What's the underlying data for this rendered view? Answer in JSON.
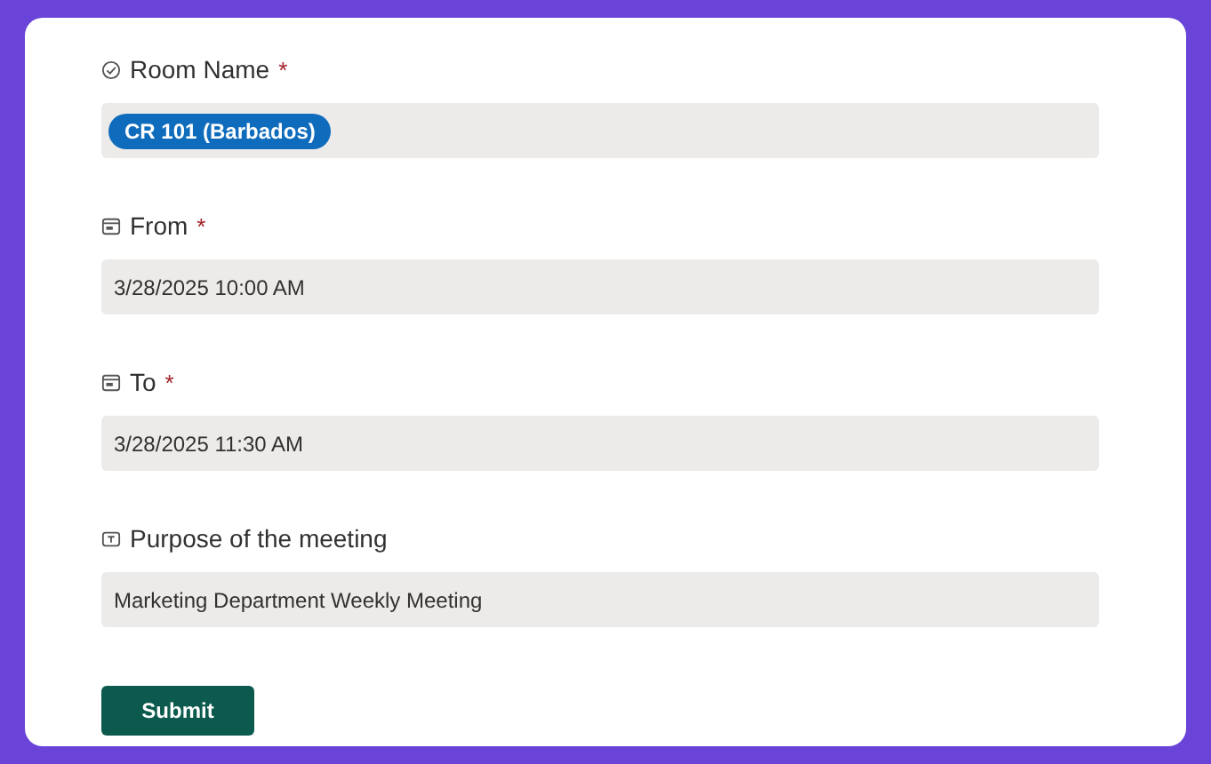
{
  "fields": [
    {
      "kind": "choice",
      "label": "Room Name",
      "required_mark": "*",
      "value": "CR 101 (Barbados)"
    },
    {
      "kind": "date",
      "label": "From",
      "required_mark": "*",
      "value": "3/28/2025 10:00 AM"
    },
    {
      "kind": "date",
      "label": "To",
      "required_mark": "*",
      "value": "3/28/2025 11:30 AM"
    },
    {
      "kind": "text",
      "label": "Purpose of the meeting",
      "value": "Marketing Department Weekly Meeting"
    }
  ],
  "submit_button": "Submit"
}
